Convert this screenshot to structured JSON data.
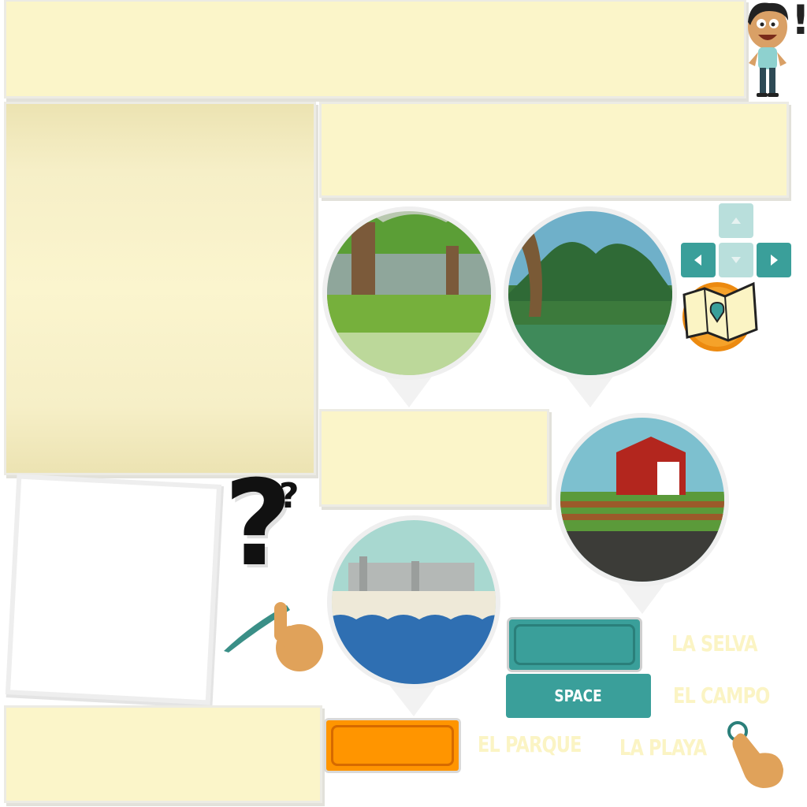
{
  "keys": {
    "space_label": "SPACE"
  },
  "destinations": {
    "selva": "LA SELVA",
    "campo": "EL CAMPO",
    "parque": "EL PARQUE",
    "playa": "LA PLAYA"
  },
  "decorations": {
    "question": "?",
    "exclaim": "!"
  },
  "colors": {
    "teal": "#3a9f9a",
    "orange": "#ff9500",
    "paper": "#fbf5c9",
    "label": "#fbf4c4"
  },
  "icons": [
    "character",
    "park-scene",
    "jungle-scene",
    "farm-scene",
    "beach-scene",
    "map-icon",
    "arrow-keys",
    "pointer-hand"
  ]
}
